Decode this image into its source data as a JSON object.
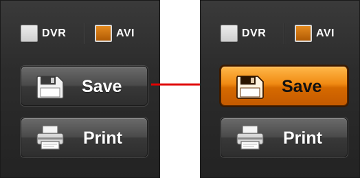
{
  "panels": [
    {
      "formats": [
        {
          "label": "DVR",
          "checked": false
        },
        {
          "label": "AVI",
          "checked": true
        }
      ],
      "save_label": "Save",
      "print_label": "Print",
      "save_state": "normal"
    },
    {
      "formats": [
        {
          "label": "DVR",
          "checked": false
        },
        {
          "label": "AVI",
          "checked": true
        }
      ],
      "save_label": "Save",
      "print_label": "Print",
      "save_state": "highlighted"
    }
  ],
  "icons": {
    "save": "floppy-disk-icon",
    "print": "printer-icon"
  },
  "colors": {
    "panel": "#2c2c2c",
    "checkbox_checked": "#d9760f",
    "save_active": "#f08a12",
    "arrow": "#e00000"
  }
}
